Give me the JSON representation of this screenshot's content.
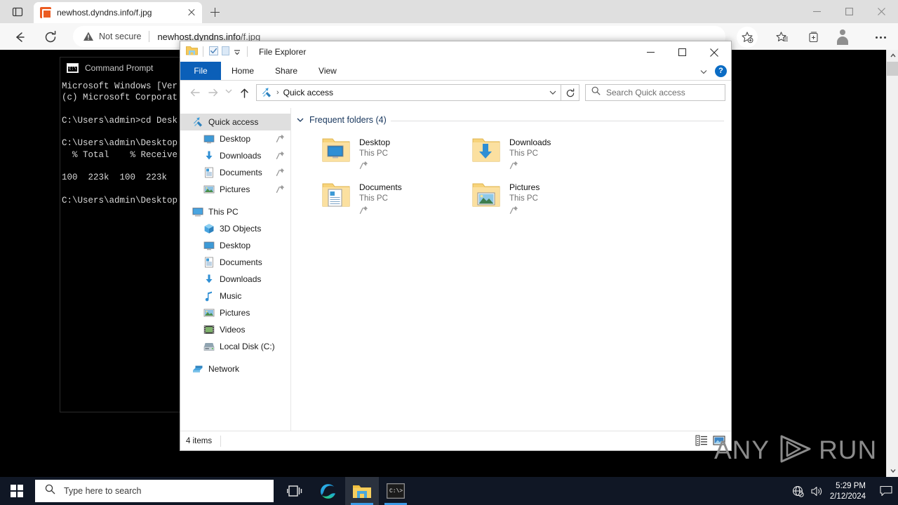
{
  "browser": {
    "tab": {
      "title": "newhost.dyndns.info/f.jpg",
      "favicon_icon": "image-file-favicon"
    },
    "new_tab_label": "+",
    "address": {
      "security_label": "Not secure",
      "url_main": "newhost.dyndns.info",
      "url_path": "/f.jpg",
      "warning_icon": "warning-triangle-icon"
    },
    "toolbar_icons": {
      "back": "back-arrow-icon",
      "reload": "reload-icon",
      "add_favorite": "star-plus-icon",
      "favorites": "favorites-list-icon",
      "collections": "collections-icon",
      "profile": "profile-avatar-icon",
      "settings_more": "more-options-icon"
    },
    "window_controls": {
      "minimize": "minimize-icon",
      "maximize": "maximize-icon",
      "close": "close-icon"
    }
  },
  "cmd": {
    "title": "Command Prompt",
    "icon": "command-prompt-icon",
    "lines": [
      "Microsoft Windows [Ver",
      "(c) Microsoft Corporat",
      "",
      "C:\\Users\\admin>cd Desk",
      "",
      "C:\\Users\\admin\\Desktop",
      "  % Total    % Receive",
      "",
      "100  223k  100  223k",
      "",
      "C:\\Users\\admin\\Desktop"
    ]
  },
  "explorer": {
    "title": "File Explorer",
    "quick_access_toolbar": [
      "properties-icon",
      "new-folder-icon",
      "customize-chevron-icon"
    ],
    "window_controls": {
      "minimize": "minimize-icon",
      "maximize": "maximize-icon",
      "close": "close-icon"
    },
    "ribbon": {
      "file_tab": "File",
      "tabs": [
        "Home",
        "Share",
        "View"
      ],
      "expand_icon": "chevron-down-icon",
      "help_label": "?"
    },
    "nav": {
      "back_icon": "back-arrow-icon",
      "forward_icon": "forward-arrow-icon",
      "recent_icon": "recent-locations-chevron-icon",
      "up_icon": "up-arrow-icon",
      "breadcrumb_icon": "quick-access-star-icon",
      "breadcrumb_separator": "›",
      "breadcrumb": "Quick access",
      "dropdown_icon": "chevron-down-icon",
      "refresh_icon": "refresh-icon",
      "search_icon": "search-icon",
      "search_placeholder": "Search Quick access"
    },
    "sidebar": {
      "groups": [
        {
          "header": {
            "label": "Quick access",
            "icon": "quick-access-star-icon",
            "selected": true
          },
          "items": [
            {
              "label": "Desktop",
              "icon": "desktop-icon",
              "pinned": true
            },
            {
              "label": "Downloads",
              "icon": "downloads-icon",
              "pinned": true
            },
            {
              "label": "Documents",
              "icon": "documents-icon",
              "pinned": true
            },
            {
              "label": "Pictures",
              "icon": "pictures-icon",
              "pinned": true
            }
          ]
        },
        {
          "header": {
            "label": "This PC",
            "icon": "this-pc-icon",
            "selected": false
          },
          "items": [
            {
              "label": "3D Objects",
              "icon": "3d-objects-icon",
              "pinned": false
            },
            {
              "label": "Desktop",
              "icon": "desktop-icon",
              "pinned": false
            },
            {
              "label": "Documents",
              "icon": "documents-icon",
              "pinned": false
            },
            {
              "label": "Downloads",
              "icon": "downloads-icon",
              "pinned": false
            },
            {
              "label": "Music",
              "icon": "music-icon",
              "pinned": false
            },
            {
              "label": "Pictures",
              "icon": "pictures-icon",
              "pinned": false
            },
            {
              "label": "Videos",
              "icon": "videos-icon",
              "pinned": false
            },
            {
              "label": "Local Disk (C:)",
              "icon": "local-disk-icon",
              "pinned": false
            }
          ]
        },
        {
          "header": {
            "label": "Network",
            "icon": "network-icon",
            "selected": false
          },
          "items": []
        }
      ]
    },
    "content": {
      "section_title": "Frequent folders (4)",
      "section_chevron": "chevron-down-icon",
      "tiles": [
        {
          "name": "Desktop",
          "location": "This PC",
          "icon": "folder-desktop-icon",
          "pinned": true
        },
        {
          "name": "Downloads",
          "location": "This PC",
          "icon": "folder-downloads-icon",
          "pinned": true
        },
        {
          "name": "Documents",
          "location": "This PC",
          "icon": "folder-documents-icon",
          "pinned": true
        },
        {
          "name": "Pictures",
          "location": "This PC",
          "icon": "folder-pictures-icon",
          "pinned": true
        }
      ]
    },
    "status": {
      "item_count": "4 items",
      "details_view_icon": "details-view-icon",
      "large_icons_view_icon": "large-icons-view-icon"
    }
  },
  "watermark": {
    "text_left": "ANY",
    "text_right": "RUN",
    "logo_icon": "anyrun-play-logo-icon"
  },
  "taskbar": {
    "start_icon": "windows-start-icon",
    "search_placeholder": "Type here to search",
    "search_icon": "search-icon",
    "apps": [
      {
        "name": "task-view",
        "icon": "task-view-icon",
        "active": false,
        "running": false
      },
      {
        "name": "microsoft-edge",
        "icon": "edge-icon",
        "active": false,
        "running": true
      },
      {
        "name": "file-explorer",
        "icon": "file-explorer-icon",
        "active": true,
        "running": true
      },
      {
        "name": "command-prompt",
        "icon": "command-prompt-icon",
        "active": false,
        "running": true
      }
    ],
    "tray": {
      "network_icon": "network-globe-icon",
      "volume_icon": "volume-icon",
      "time": "5:29 PM",
      "date": "2/12/2024",
      "notifications_icon": "notification-icon"
    }
  },
  "colors": {
    "ribbon_file_blue": "#0b5fb8",
    "taskbar": "#101725",
    "accent_blue": "#3b9ae5",
    "section_title": "#17365d"
  }
}
